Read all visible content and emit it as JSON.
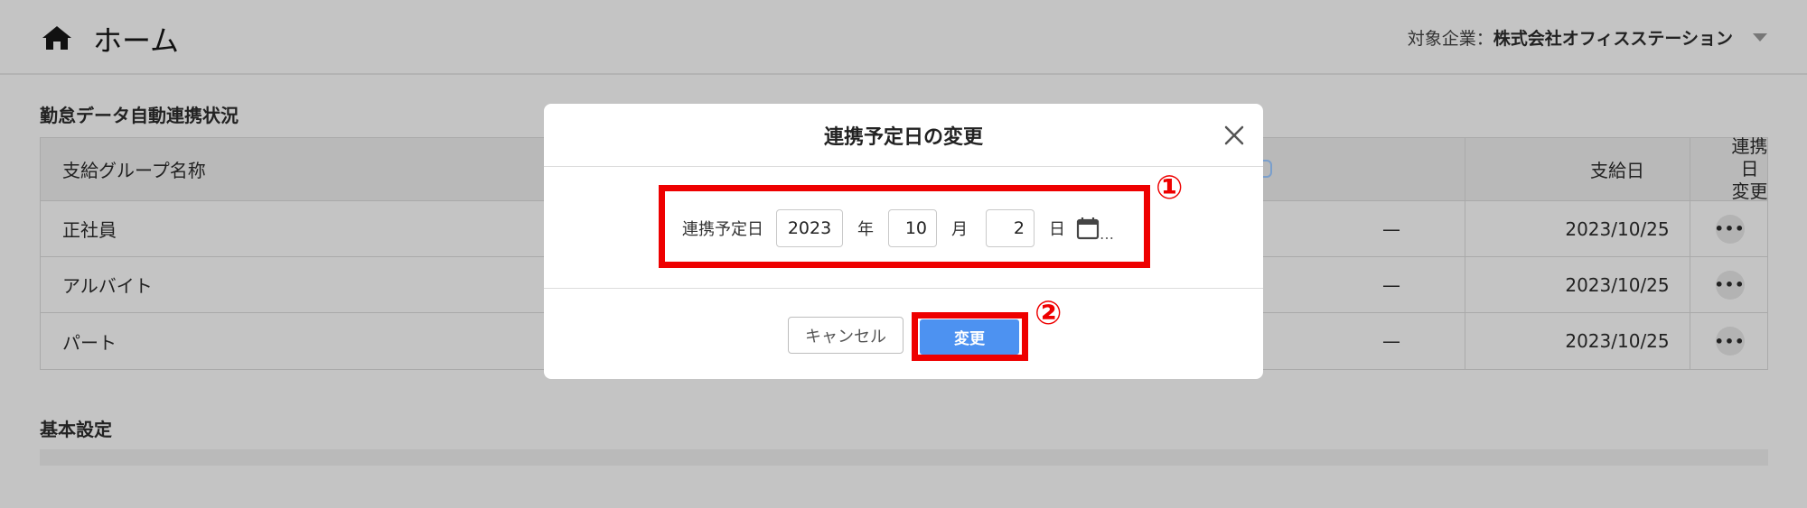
{
  "header": {
    "title": "ホーム",
    "company_label": "対象企業：",
    "company_name": "株式会社オフィスステーション"
  },
  "sections": {
    "sync_status": "勤怠データ自動連携状況",
    "basic_settings": "基本設定"
  },
  "table": {
    "headers": {
      "group_name": "支給グループ名称",
      "pay_date": "支給日",
      "change_line1": "連携日",
      "change_line2": "変更"
    },
    "rows": [
      {
        "name": "正社員",
        "status": "—",
        "pay_date": "2023/10/25",
        "action": "•••"
      },
      {
        "name": "アルバイト",
        "status": "—",
        "pay_date": "2023/10/25",
        "action": "•••"
      },
      {
        "name": "パート",
        "status": "—",
        "pay_date": "2023/10/25",
        "action": "•••"
      }
    ]
  },
  "modal": {
    "title": "連携予定日の変更",
    "field_label": "連携予定日",
    "year_value": "2023",
    "year_unit": "年",
    "month_value": "10",
    "month_unit": "月",
    "day_value": "2",
    "day_unit": "日",
    "ellipsis": "…",
    "cancel_label": "キャンセル",
    "submit_label": "変更"
  },
  "annotations": {
    "marker1": "①",
    "marker2": "②"
  },
  "colors": {
    "overlay_bg": "#c4c4c4",
    "primary": "#4d92f1",
    "highlight": "#ee0000"
  },
  "icons": [
    "home-icon",
    "chevron-down-icon",
    "close-icon",
    "calendar-icon",
    "more-icon"
  ]
}
